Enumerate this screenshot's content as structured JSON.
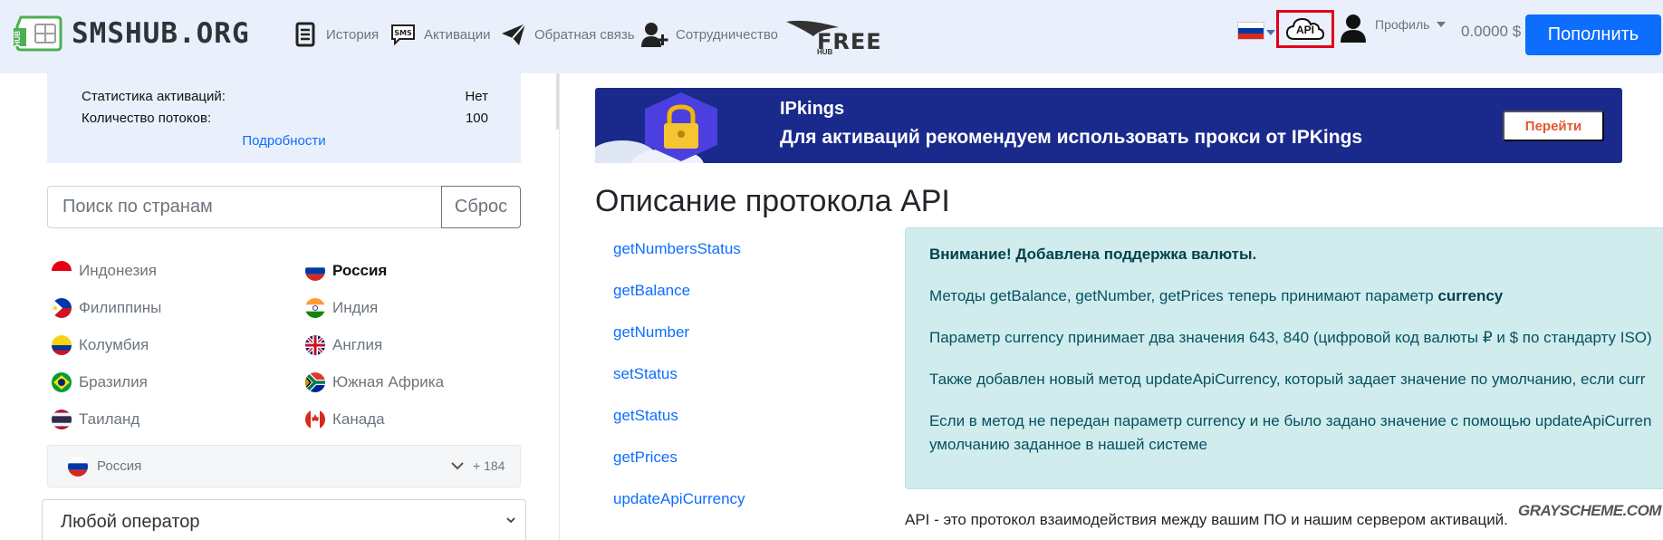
{
  "navbar": {
    "logo_text": "SMSHUB.ORG",
    "logo_sub": "HUB",
    "items": [
      {
        "label": "История",
        "icon": "document-icon"
      },
      {
        "label": "Активации",
        "icon": "sms-icon"
      },
      {
        "label": "Обратная связь",
        "icon": "paper-plane-icon"
      },
      {
        "label": "Сотрудничество",
        "icon": "add-user-icon"
      }
    ],
    "hubfree": {
      "hub": "HUB",
      "free": "FREE"
    },
    "api_label": "API",
    "profile_label": "Профиль",
    "balance": "0.0000 $",
    "topup_label": "Пополнить"
  },
  "stats": {
    "rows": [
      {
        "label": "Статистика активаций:",
        "value": "Нет"
      },
      {
        "label": "Количество потоков:",
        "value": "100"
      }
    ],
    "details_link": "Подробности"
  },
  "search": {
    "placeholder": "Поиск по странам",
    "reset_label": "Сброс"
  },
  "countries": [
    {
      "name": "Индонезия",
      "flag": "id",
      "selected": false
    },
    {
      "name": "Россия",
      "flag": "ru",
      "selected": true
    },
    {
      "name": "Филиппины",
      "flag": "ph",
      "selected": false
    },
    {
      "name": "Индия",
      "flag": "in",
      "selected": false
    },
    {
      "name": "Колумбия",
      "flag": "co",
      "selected": false
    },
    {
      "name": "Англия",
      "flag": "gb",
      "selected": false
    },
    {
      "name": "Бразилия",
      "flag": "br",
      "selected": false
    },
    {
      "name": "Южная Африка",
      "flag": "za",
      "selected": false
    },
    {
      "name": "Таиланд",
      "flag": "th",
      "selected": false
    },
    {
      "name": "Канада",
      "flag": "ca",
      "selected": false
    }
  ],
  "selected_country": {
    "name": "Россия",
    "more_count": "+ 184"
  },
  "operator": {
    "value": "Любой оператор"
  },
  "banner": {
    "brand": "IPkings",
    "text": "Для активаций рекомендуем использовать прокси от IPKings",
    "button": "Перейти"
  },
  "main": {
    "title": "Описание протокола API",
    "methods": [
      "getNumbersStatus",
      "getBalance",
      "getNumber",
      "setStatus",
      "getStatus",
      "getPrices",
      "updateApiCurrency"
    ],
    "alert": {
      "heading": "Внимание! Добавлена поддержка валюты.",
      "line1_prefix": "Методы getBalance, getNumber, getPrices теперь принимают параметр ",
      "line1_bold": "currency",
      "line2": "Параметр currency принимает два значения 643, 840 (цифровой код валюты ₽ и $ по стандарту ISO)",
      "line3": "Также добавлен новый метод updateApiCurrency, который задает значение по умолчанию, если curr",
      "line4": "Если в метод не передан параметр currency и не было задано значение с помощью updateApiCurren",
      "line5": "умолчанию заданное в нашей системе"
    },
    "api_description": "API - это протокол взаимодействия между вашим ПО и нашим сервером активаций."
  },
  "watermark": "GRAYSCHEME.COM"
}
